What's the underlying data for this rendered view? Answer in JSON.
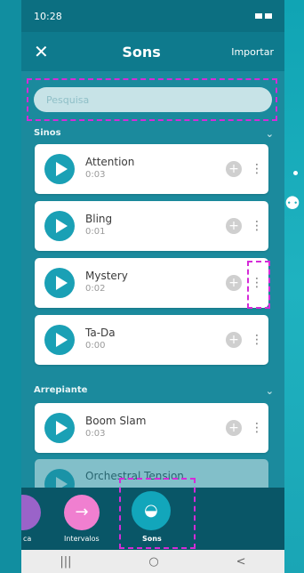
{
  "status": {
    "time": "10:28"
  },
  "header": {
    "title": "Sons",
    "import_label": "Importar",
    "close_label": "✕"
  },
  "search": {
    "placeholder": "Pesquisa"
  },
  "sections": [
    {
      "title": "Sinos",
      "chevron": "⌄"
    },
    {
      "title": "Arrepiante",
      "chevron": "⌄"
    }
  ],
  "sounds": [
    {
      "name": "Attention",
      "duration": "0:03"
    },
    {
      "name": "Bling",
      "duration": "0:01"
    },
    {
      "name": "Mystery",
      "duration": "0:02"
    },
    {
      "name": "Ta-Da",
      "duration": "0:00"
    },
    {
      "name": "Boom Slam",
      "duration": "0:03"
    },
    {
      "name": "Orchestral Tension",
      "duration": ""
    }
  ],
  "tabs": [
    {
      "label": "ca",
      "color": "#9a63c9"
    },
    {
      "label": "Intervalos",
      "color": "#f07fd0"
    },
    {
      "label": "Sons",
      "color": "#12a6bb"
    }
  ],
  "navbar": {
    "recent": "|||",
    "home": "○",
    "back": "<"
  }
}
